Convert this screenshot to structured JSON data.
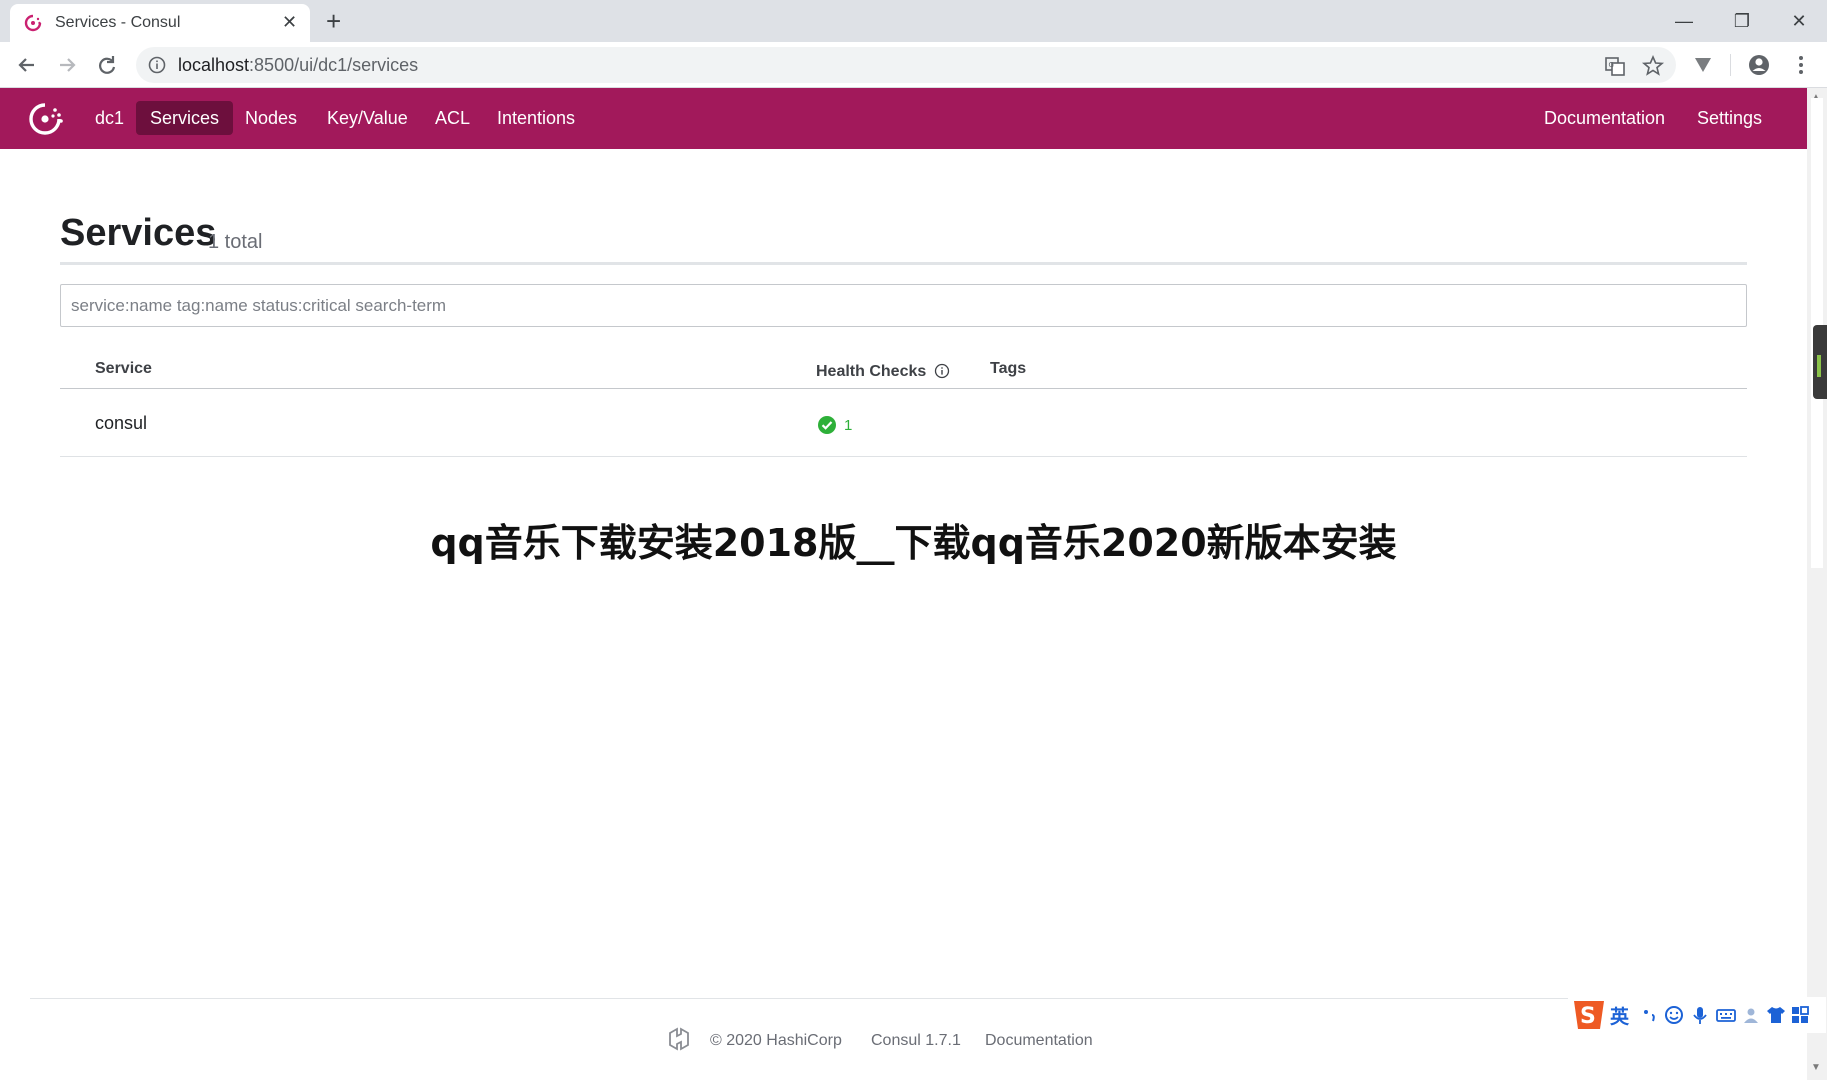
{
  "browser": {
    "tab_title": "Services - Consul",
    "close_glyph": "✕",
    "new_tab_glyph": "+",
    "url_host": "localhost",
    "url_rest": ":8500/ui/dc1/services",
    "window_controls": {
      "minimize": "—",
      "maximize": "❐",
      "close": "✕"
    }
  },
  "header": {
    "datacenter": "dc1",
    "nav": [
      "Services",
      "Nodes",
      "Key/Value",
      "ACL",
      "Intentions"
    ],
    "active_nav": "Services",
    "right_nav": [
      "Documentation",
      "Settings"
    ],
    "bg_color": "#a2195b"
  },
  "main": {
    "title": "Services",
    "count": "1 total",
    "search_placeholder": "service:name tag:name status:critical search-term",
    "columns": {
      "service": "Service",
      "health": "Health Checks",
      "tags": "Tags"
    },
    "rows": [
      {
        "service": "consul",
        "passing": "1",
        "tags": ""
      }
    ]
  },
  "overlay_title": "qq音乐下载安装2018版__下载qq音乐2020新版本安装",
  "footer": {
    "copyright": "© 2020 HashiCorp",
    "version": "Consul 1.7.1",
    "docs": "Documentation"
  },
  "ime": {
    "mode": "英"
  },
  "icons": {
    "favicon": "consul-icon",
    "translate": "translate-icon",
    "bookmark": "star-icon",
    "extension": "extension-icon",
    "profile": "account-icon",
    "menu": "kebab-menu-icon"
  }
}
